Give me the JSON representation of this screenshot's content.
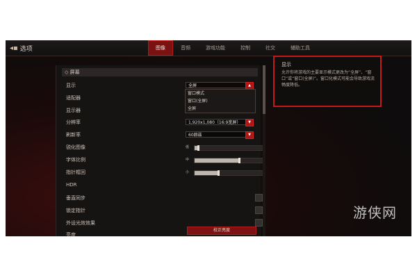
{
  "topbar": {
    "back_label": "选项",
    "tabs": [
      "图像",
      "音频",
      "游戏功能",
      "控制",
      "社交",
      "辅助工具"
    ],
    "active_tab": "图像"
  },
  "section": {
    "title": "屏幕"
  },
  "settings": {
    "display_mode": {
      "label": "显示",
      "value": "全屏"
    },
    "adapter": {
      "label": "适配器"
    },
    "monitor": {
      "label": "显示器"
    },
    "resolution": {
      "label": "分辨率",
      "value": "1,920x1,080（16:9宽屏）"
    },
    "refresh_rate": {
      "label": "刷新率",
      "value": "60赫兹"
    },
    "sharpen": {
      "label": "锐化图像",
      "prefix": "低",
      "level": 0.05
    },
    "font_scale": {
      "label": "字体比例",
      "prefix": "中",
      "level": 0.65
    },
    "cursor_scale": {
      "label": "指针框回",
      "prefix": "小",
      "level": 0.35
    },
    "hdr": {
      "label": "HDR"
    },
    "vsync": {
      "label": "垂直同步"
    },
    "lock_cursor": {
      "label": "锁定指针"
    },
    "ambient": {
      "label": "外设光效效果"
    },
    "brightness": {
      "label": "亮度",
      "button": "校正亮度"
    }
  },
  "dropdown_menu": {
    "options": [
      "窗口模式",
      "窗口(全屏)",
      "全屏"
    ]
  },
  "help": {
    "title": "显示",
    "text": "允许你将游戏的主要显示模式更改为“全屏”、“窗口”或“窗口(全屏)”。窗口化模式可能会导致游戏流畅度降低。"
  },
  "watermark": "游侠网"
}
